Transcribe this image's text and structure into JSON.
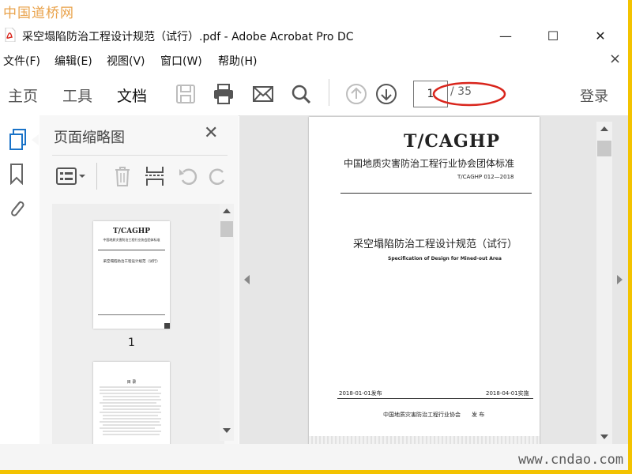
{
  "watermarks": {
    "top_left": "中国道桥网",
    "bottom_right": "www.cndao.com"
  },
  "window": {
    "title": "采空塌陷防治工程设计规范（试行）.pdf - Adobe Acrobat Pro DC",
    "minimize_glyph": "—",
    "maximize_glyph": "☐",
    "close_glyph": "✕"
  },
  "menu": {
    "items": [
      "文件(F)",
      "编辑(E)",
      "视图(V)",
      "窗口(W)",
      "帮助(H)"
    ],
    "close_glyph": "×"
  },
  "toolbar": {
    "tabs": [
      "主页",
      "工具",
      "文档"
    ],
    "active_tab": "文档",
    "page_current": "1",
    "page_total": "/ 35",
    "login": "登录"
  },
  "thumb_panel": {
    "title": "页面缩略图",
    "close_glyph": "✕",
    "page1_label": "1",
    "thumb1": {
      "title": "T/CAGHP",
      "subtitle": "中国地质灾害防治工程行业协会团体标准",
      "doc_title": "采空塌陷防治工程设计规范（试行）"
    },
    "thumb2": {
      "heading": "目  录"
    }
  },
  "document": {
    "code": "T/CAGHP",
    "org_standard": "中国地质灾害防治工程行业协会团体标准",
    "std_number": "T/CAGHP 012—2018",
    "title_cn": "采空塌陷防治工程设计规范（试行）",
    "title_en": "Specification of Design for Mined-out Area",
    "publish_date": "2018-01-01发布",
    "implement_date": "2018-04-01实施",
    "issuer": "中国地质灾害防治工程行业协会",
    "issue_word": "发  布"
  },
  "colors": {
    "accent_red": "#d9251c",
    "border": "#d9d9d9",
    "frame": "#f3c300"
  }
}
